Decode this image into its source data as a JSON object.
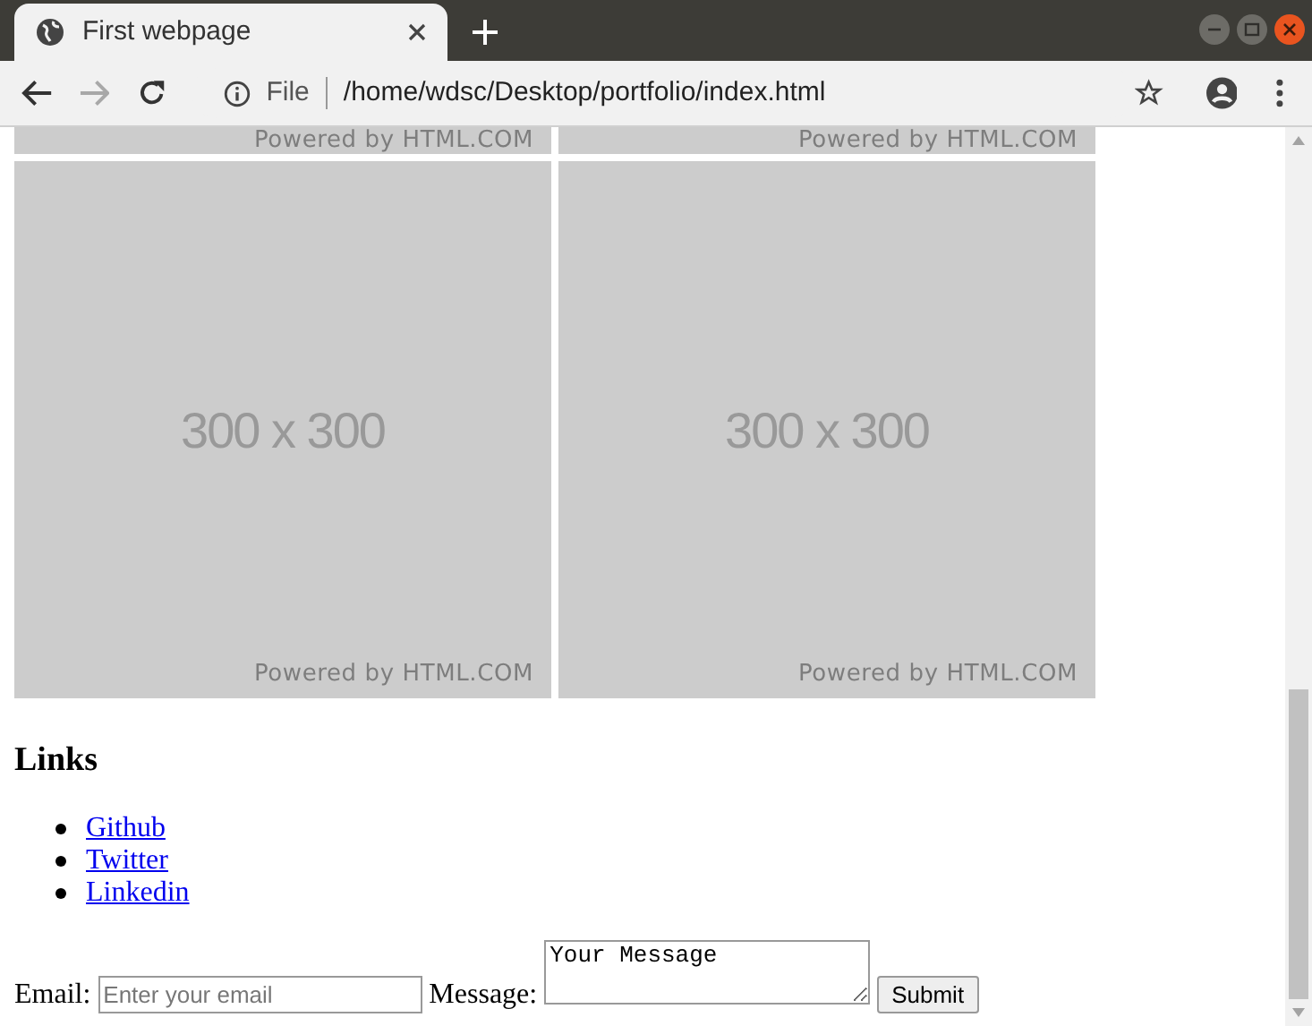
{
  "browser": {
    "tab_title": "First webpage",
    "file_label": "File",
    "url": "/home/wdsc/Desktop/portfolio/index.html",
    "forward_disabled": true
  },
  "image_rows": [
    [
      {
        "footer": "Powered by HTML.COM"
      },
      {
        "footer": "Powered by HTML.COM"
      }
    ],
    [
      {
        "size_label": "300 x 300",
        "footer": "Powered by HTML.COM"
      },
      {
        "size_label": "300 x 300",
        "footer": "Powered by HTML.COM"
      }
    ]
  ],
  "links": {
    "heading": "Links",
    "items": [
      "Github",
      "Twitter",
      "Linkedin"
    ]
  },
  "form": {
    "email_label": "Email:",
    "email_placeholder": "Enter your email",
    "message_label": "Message:",
    "message_value": "Your Message",
    "submit": "Submit"
  }
}
